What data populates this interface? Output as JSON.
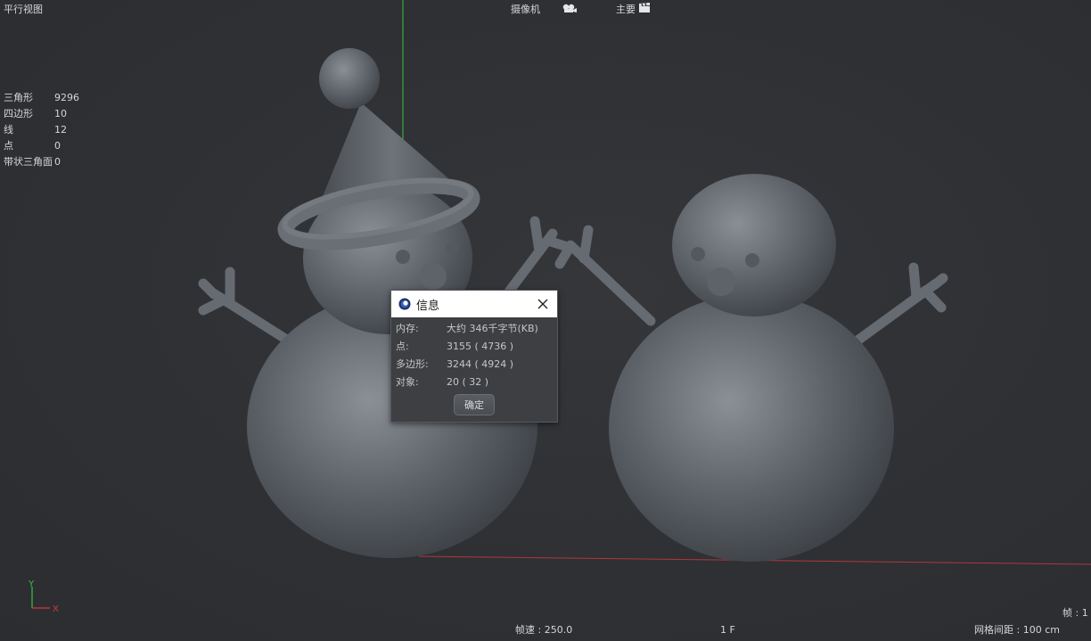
{
  "viewport": {
    "view_name": "平行视图",
    "camera_label": "摄像机",
    "camera_icon": "camera-icon",
    "display_label": "主要",
    "display_icon": "clapper-icon"
  },
  "stats": [
    {
      "label": "三角形",
      "value": "9296"
    },
    {
      "label": "四边形",
      "value": "10"
    },
    {
      "label": "线",
      "value": "12"
    },
    {
      "label": "点",
      "value": "0"
    },
    {
      "label": "带状三角面",
      "value": "0"
    }
  ],
  "dialog": {
    "title": "信息",
    "rows": [
      {
        "label": "内存:",
        "value": "大约 346千字节(KB)"
      },
      {
        "label": "点:",
        "value": "3155 ( 4736 )"
      },
      {
        "label": "多边形:",
        "value": "3244 ( 4924 )"
      },
      {
        "label": "对象:",
        "value": "20 ( 32 )"
      }
    ],
    "ok_label": "确定"
  },
  "status": {
    "frame_rate": "帧速 : 250.0",
    "frame_number": "1 F",
    "grid_spacing": "网格间距 : 100 cm",
    "frame_label": "帧 : 1"
  },
  "axes": {
    "y_label": "Y",
    "x_label": "X",
    "y_color": "#3fbf3f",
    "x_color": "#d23a3a"
  },
  "colors": {
    "background": "#2e3034",
    "model": "#6b7076",
    "dialog_bg": "#3d3f43"
  }
}
